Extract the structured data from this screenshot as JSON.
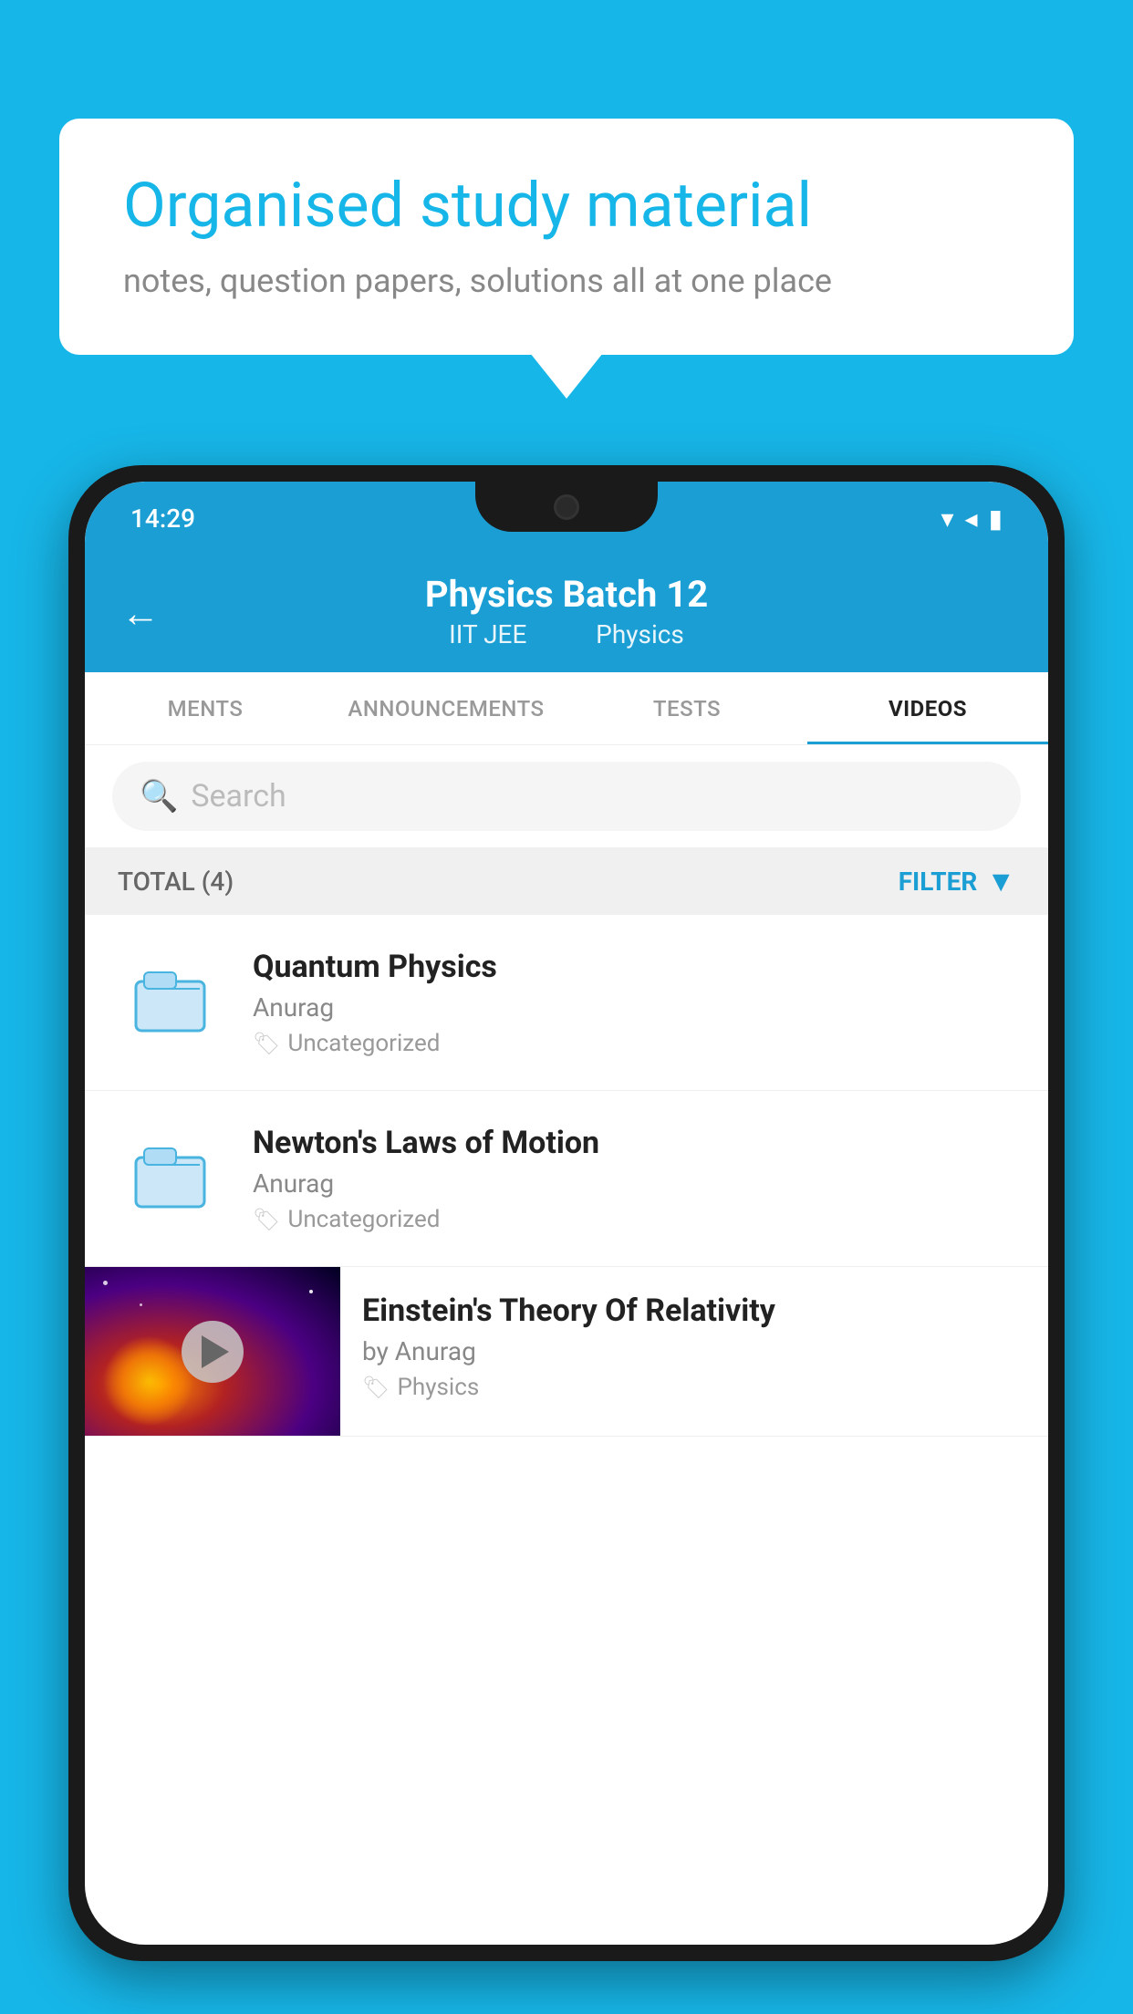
{
  "background": {
    "color": "#17b6e8"
  },
  "speech_bubble": {
    "title": "Organised study material",
    "subtitle": "notes, question papers, solutions all at one place"
  },
  "phone": {
    "status_bar": {
      "time": "14:29"
    },
    "header": {
      "back_label": "←",
      "title": "Physics Batch 12",
      "subtitle_part1": "IIT JEE",
      "subtitle_part2": "Physics"
    },
    "tabs": [
      {
        "label": "MENTS",
        "active": false
      },
      {
        "label": "ANNOUNCEMENTS",
        "active": false
      },
      {
        "label": "TESTS",
        "active": false
      },
      {
        "label": "VIDEOS",
        "active": true
      }
    ],
    "search": {
      "placeholder": "Search"
    },
    "filter_row": {
      "total_label": "TOTAL (4)",
      "filter_label": "FILTER"
    },
    "videos": [
      {
        "title": "Quantum Physics",
        "author": "Anurag",
        "tag": "Uncategorized",
        "has_thumbnail": false
      },
      {
        "title": "Newton's Laws of Motion",
        "author": "Anurag",
        "tag": "Uncategorized",
        "has_thumbnail": false
      },
      {
        "title": "Einstein's Theory Of Relativity",
        "author": "by Anurag",
        "tag": "Physics",
        "has_thumbnail": true
      }
    ]
  }
}
